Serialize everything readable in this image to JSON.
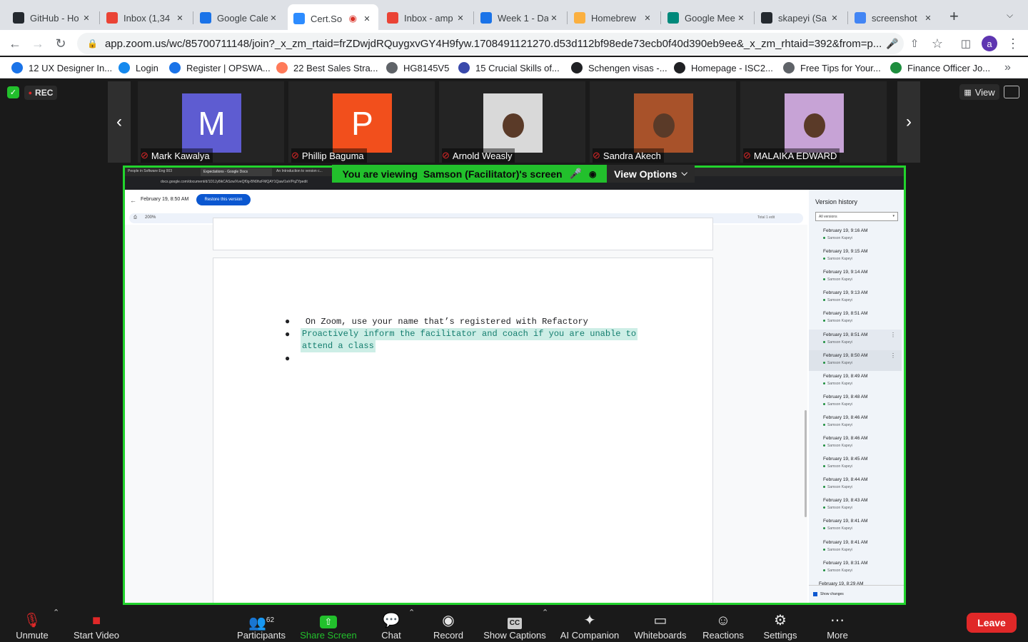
{
  "browser": {
    "tabs": [
      {
        "label": "GitHub - Ho",
        "icon": "github-icon",
        "color": "#24292f"
      },
      {
        "label": "Inbox (1,34",
        "icon": "gmail-icon",
        "color": "#ea4335"
      },
      {
        "label": "Google Cale",
        "icon": "calendar-icon",
        "color": "#1a73e8"
      },
      {
        "label": "Cert.So",
        "icon": "zoom-icon",
        "color": "#2d8cff",
        "active": true
      },
      {
        "label": "Inbox - amp",
        "icon": "gmail-icon",
        "color": "#ea4335"
      },
      {
        "label": "Week 1 - Da",
        "icon": "contacts-icon",
        "color": "#1a73e8"
      },
      {
        "label": "Homebrew",
        "icon": "homebrew-icon",
        "color": "#fbb040"
      },
      {
        "label": "Google Mee",
        "icon": "meet-icon",
        "color": "#00897b"
      },
      {
        "label": "skapeyi (Sa",
        "icon": "github-icon",
        "color": "#24292f"
      },
      {
        "label": "screenshot",
        "icon": "google-icon",
        "color": "#4285f4"
      }
    ],
    "new_tab": "+",
    "url": "app.zoom.us/wc/85700711148/join?_x_zm_rtaid=frZDwjdRQuygxvGY4H9fyw.1708491121270.d53d112bf98ede73ecb0f40d390eb9ee&_x_zm_rhtaid=392&from=p...",
    "profile_initial": "a",
    "bookmarks": [
      {
        "label": "12 UX Designer In...",
        "color": "#1a73e8"
      },
      {
        "label": "Login",
        "color": "#1589ee"
      },
      {
        "label": "Register | OPSWA...",
        "color": "#1a73e8"
      },
      {
        "label": "22 Best Sales Stra...",
        "color": "#ff7a59"
      },
      {
        "label": "HG8145V5",
        "color": "#5f6368"
      },
      {
        "label": "15 Crucial Skills of...",
        "color": "#3949ab"
      },
      {
        "label": "Schengen visas -...",
        "color": "#202124"
      },
      {
        "label": "Homepage - ISC2...",
        "color": "#202124"
      },
      {
        "label": "Free Tips for Your...",
        "color": "#5f6368"
      },
      {
        "label": "Finance Officer Jo...",
        "color": "#1e8e3e"
      }
    ],
    "more_bookmarks": "»"
  },
  "zoom": {
    "recording_badge": "REC",
    "view_button": "View",
    "participants_strip": [
      {
        "name": "Mark Kawalya",
        "initial": "M",
        "bg": "#5e5cd1"
      },
      {
        "name": "Phillip Baguma",
        "initial": "P",
        "bg": "#f24f1c"
      },
      {
        "name": "Arnold Weasly",
        "initial": "",
        "bg": "#d9d9d9"
      },
      {
        "name": "Sandra Akech",
        "initial": "",
        "bg": "#a8522a"
      },
      {
        "name": "MALAIKA EDWARD",
        "initial": "",
        "bg": "#c7a3d6"
      }
    ],
    "viewing_banner": "You are viewing  Samson (Facilitator)'s screen",
    "view_options": "View Options",
    "toolbar": {
      "unmute": "Unmute",
      "start_video": "Start Video",
      "participants": "Participants",
      "participants_count": "62",
      "share_screen": "Share Screen",
      "chat": "Chat",
      "record": "Record",
      "show_captions": "Show Captions",
      "ai_companion": "AI Companion",
      "whiteboards": "Whiteboards",
      "reactions": "Reactions",
      "settings": "Settings",
      "more": "More",
      "leave": "Leave"
    }
  },
  "shared_doc": {
    "inner_tabs": [
      "People in Software Eng 003",
      "Expectations - Google Docs",
      "An Introduction to version c..."
    ],
    "inner_url": "docs.google.com/document/d/1D1Jy8ikCASzw/XveQf0g-BN9hzFMQAY1Qaw/1wVPqZYpedit",
    "version_date": "February 19, 8:50 AM",
    "restore_button": "Restore this version",
    "zoom_level": "200%",
    "total_edits": "Total 1 edit",
    "bullets": [
      "On Zoom, use your name that’s registered with Refactory",
      "Proactively inform the facilitator and coach if you are unable to attend a class",
      ""
    ],
    "bullet_line2": "attend a class",
    "version_history": {
      "title": "Version history",
      "filter": "All versions",
      "show_changes": "Show changes",
      "author": "Samson Kapeyi",
      "items": [
        "February 19, 9:16 AM",
        "February 19, 9:15 AM",
        "February 19, 9:14 AM",
        "February 19, 9:13 AM",
        "February 19, 8:51 AM",
        "February 19, 8:51 AM",
        "February 19, 8:50 AM",
        "February 19, 8:49 AM",
        "February 19, 8:48 AM",
        "February 19, 8:46 AM",
        "February 19, 8:46 AM",
        "February 19, 8:45 AM",
        "February 19, 8:44 AM",
        "February 19, 8:43 AM",
        "February 19, 8:41 AM",
        "February 19, 8:41 AM",
        "February 19, 8:31 AM",
        "February 19, 8:29 AM"
      ]
    }
  }
}
